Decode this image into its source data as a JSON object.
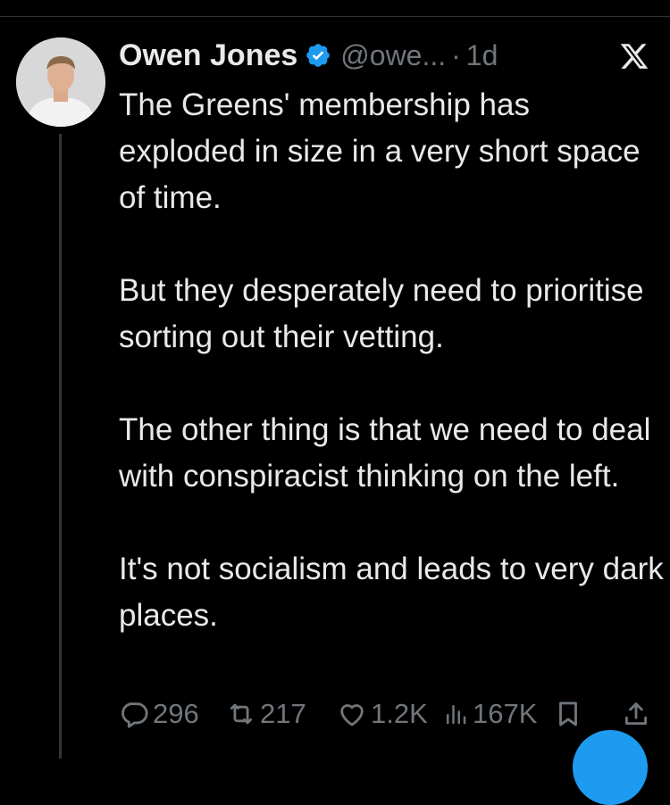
{
  "tweet": {
    "author_name": "Owen Jones",
    "handle": "@owe...",
    "separator": "·",
    "time": "1d",
    "paragraphs": [
      "The Greens' membership has exploded in size in a very short space of time.",
      "But they desperately need to prioritise sorting out their vetting.",
      "The other thing is that we need to deal with conspiracist thinking on the left.",
      "It's not socialism and leads to very dark places."
    ]
  },
  "metrics": {
    "replies": "296",
    "reposts": "217",
    "likes": "1.2K",
    "views": "167K"
  },
  "icons": {
    "verified": "verified-badge-icon",
    "platform": "x-logo-icon",
    "reply": "reply-icon",
    "repost": "repost-icon",
    "like": "heart-icon",
    "views": "views-icon",
    "bookmark": "bookmark-icon",
    "share": "share-icon"
  },
  "colors": {
    "background": "#000000",
    "text": "#e7e9ea",
    "muted": "#71767b",
    "accent": "#1d9bf0"
  }
}
